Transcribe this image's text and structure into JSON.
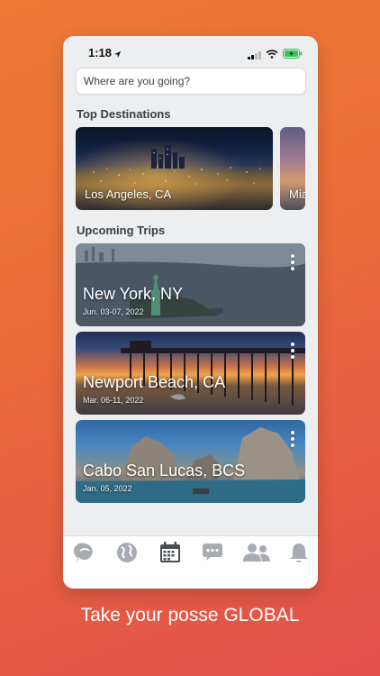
{
  "status_bar": {
    "time": "1:18"
  },
  "search": {
    "placeholder": "Where are you going?"
  },
  "top_destinations": {
    "title": "Top Destinations",
    "items": [
      {
        "label": "Los Angeles, CA"
      },
      {
        "label": "Mia"
      }
    ]
  },
  "upcoming_trips": {
    "title": "Upcoming Trips",
    "items": [
      {
        "title": "New York, NY",
        "date": "Jun. 03-07, 2022"
      },
      {
        "title": "Newport Beach, CA",
        "date": "Mar. 06-11, 2022"
      },
      {
        "title": "Cabo San Lucas, BCS",
        "date": "Jan. 05, 2022"
      }
    ]
  },
  "tab_bar": {
    "items": [
      {
        "icon": "chat-bubble-icon"
      },
      {
        "icon": "globe-icon"
      },
      {
        "icon": "calendar-icon"
      },
      {
        "icon": "messages-icon"
      },
      {
        "icon": "people-icon"
      },
      {
        "icon": "bell-icon"
      }
    ],
    "active_color": "#4a4d52",
    "inactive_color": "#a8abb0"
  },
  "tagline": "Take your posse GLOBAL"
}
